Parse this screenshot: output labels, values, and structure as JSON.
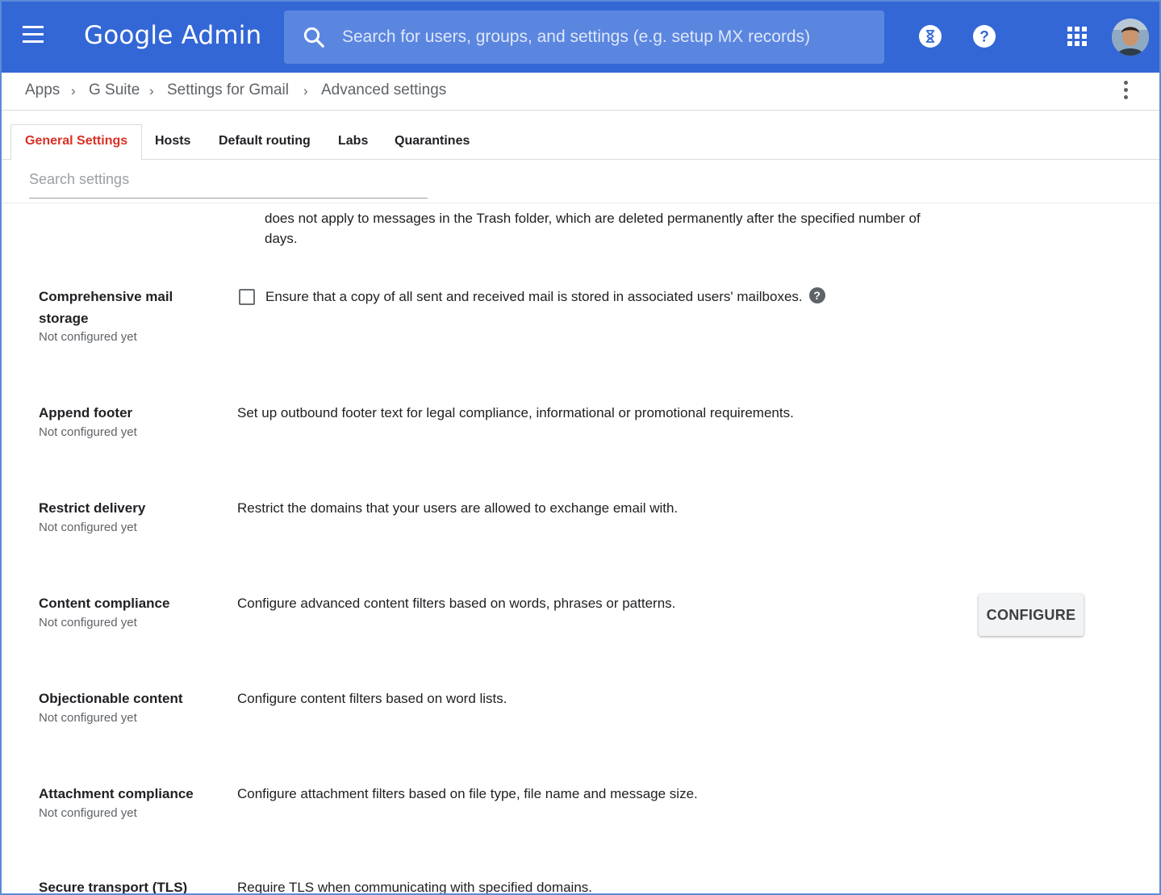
{
  "header": {
    "brand_google": "Google",
    "brand_admin": "Admin",
    "search_placeholder": "Search for users, groups, and settings (e.g. setup MX records)",
    "colors": {
      "bar": "#3367d6",
      "search_bg": "#5a86e0"
    },
    "icons": [
      "menu-icon",
      "search-icon",
      "hourglass-icon",
      "help-icon",
      "apps-grid-icon",
      "avatar"
    ]
  },
  "breadcrumb": {
    "items": [
      "Apps",
      "G Suite",
      "Settings for Gmail",
      "Advanced settings"
    ]
  },
  "tabs": [
    {
      "label": "General Settings",
      "active": true
    },
    {
      "label": "Hosts"
    },
    {
      "label": "Default routing"
    },
    {
      "label": "Labs"
    },
    {
      "label": "Quarantines"
    }
  ],
  "settings_search": {
    "placeholder": "Search settings"
  },
  "partial_text": {
    "line1": "does not apply to messages in the Trash folder, which are deleted permanently after the specified number of",
    "line2": "days."
  },
  "settings": [
    {
      "title_line1": "Comprehensive mail",
      "title_line2": "storage",
      "status": "Not configured yet",
      "description": "Ensure that a copy of all sent and received mail is stored in associated users' mailboxes.",
      "help": "?"
    },
    {
      "title": "Append footer",
      "status": "Not configured yet",
      "description": "Set up outbound footer text for legal compliance, informational or promotional requirements."
    },
    {
      "title": "Restrict delivery",
      "status": "Not configured yet",
      "description": "Restrict the domains that your users are allowed to exchange email with."
    },
    {
      "title": "Content compliance",
      "status": "Not configured yet",
      "description": "Configure advanced content filters based on words, phrases or patterns.",
      "button": "CONFIGURE"
    },
    {
      "title": "Objectionable content",
      "status": "Not configured yet",
      "description": "Configure content filters based on word lists."
    },
    {
      "title": "Attachment compliance",
      "status": "Not configured yet",
      "description": "Configure attachment filters based on file type, file name and message size."
    },
    {
      "title": "Secure transport (TLS)",
      "description": "Require TLS when communicating with specified domains."
    }
  ],
  "active_tab_color": "#d93025"
}
